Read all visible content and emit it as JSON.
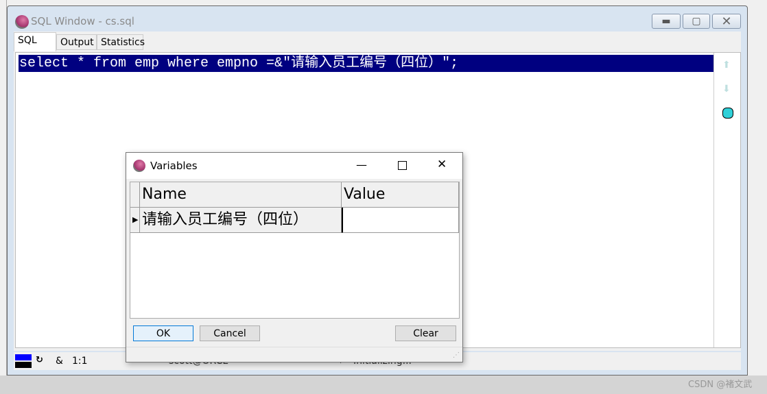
{
  "window": {
    "title": "SQL Window - cs.sql",
    "minimize_icon": "minimize-icon",
    "maximize_icon": "maximize-icon",
    "close_icon": "close-icon"
  },
  "tabs": [
    {
      "label": "SQL",
      "active": true
    },
    {
      "label": "Output"
    },
    {
      "label": "Statistics"
    }
  ],
  "editor": {
    "code": "select * from emp where empno =&\"请输入员工编号（四位）\";",
    "selection_color": "#000080"
  },
  "status": {
    "position": "1:1",
    "ampersand": "&",
    "connection": "scott@ORCL",
    "message": "Initializing..."
  },
  "dialog": {
    "title": "Variables",
    "columns": [
      "Name",
      "Value"
    ],
    "rows": [
      {
        "name": "请输入员工编号（四位）",
        "value": ""
      }
    ],
    "ok": "OK",
    "cancel": "Cancel",
    "clear": "Clear"
  },
  "watermark": "CSDN @褚文武"
}
